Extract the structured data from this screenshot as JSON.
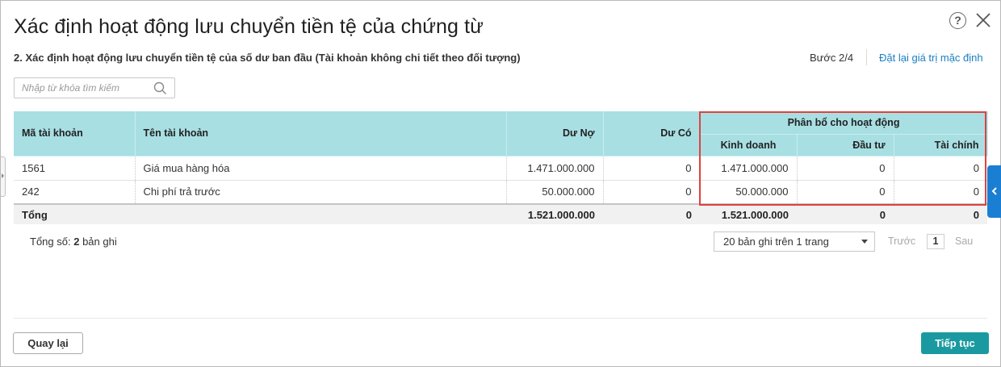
{
  "dialog": {
    "title": "Xác định hoạt động lưu chuyển tiền tệ của chứng từ",
    "subtitle": "2. Xác định hoạt động lưu chuyển tiền tệ của số dư ban đầu (Tài khoản không chi tiết theo đối tượng)",
    "step": "Bước 2/4",
    "reset_label": "Đặt lại giá trị mặc định",
    "help_icon": "question-circle-icon",
    "close_icon": "close-icon"
  },
  "search": {
    "placeholder": "Nhập từ khóa tìm kiếm",
    "value": "",
    "icon": "search-icon"
  },
  "table": {
    "columns": {
      "account_code": "Mã tài khoản",
      "account_name": "Tên tài khoản",
      "debit": "Dư Nợ",
      "credit": "Dư Có",
      "allocation_group": "Phân bổ cho hoạt động",
      "operating": "Kinh doanh",
      "investing": "Đầu tư",
      "financing": "Tài chính"
    },
    "rows": [
      {
        "account_code": "1561",
        "account_name": "Giá mua hàng hóa",
        "debit": "1.471.000.000",
        "credit": "0",
        "operating": "1.471.000.000",
        "investing": "0",
        "financing": "0"
      },
      {
        "account_code": "242",
        "account_name": "Chi phí trả trước",
        "debit": "50.000.000",
        "credit": "0",
        "operating": "50.000.000",
        "investing": "0",
        "financing": "0"
      }
    ],
    "total": {
      "label": "Tổng",
      "debit": "1.521.000.000",
      "credit": "0",
      "operating": "1.521.000.000",
      "investing": "0",
      "financing": "0"
    }
  },
  "pagination": {
    "total_prefix": "Tổng số:",
    "total_count": "2",
    "total_suffix": "bản ghi",
    "page_size": "20 bản ghi trên 1 trang",
    "prev_label": "Trước",
    "current_page": "1",
    "next_label": "Sau"
  },
  "footer": {
    "back_label": "Quay lại",
    "next_label": "Tiếp tục"
  },
  "colors": {
    "header_bg": "#a8dfe3",
    "primary_button": "#1a9aa0",
    "link": "#1a7fc1",
    "highlight_border": "#e0423e",
    "side_tab": "#1a7fd3"
  }
}
